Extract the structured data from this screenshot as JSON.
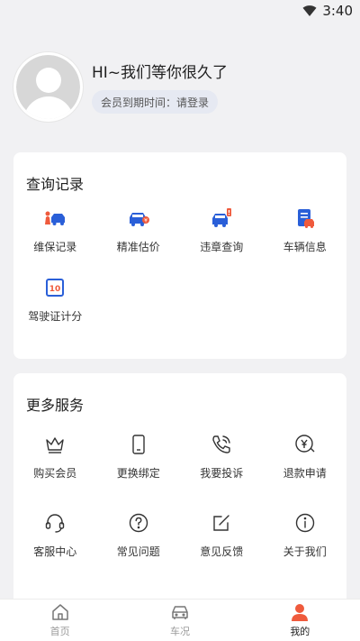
{
  "status_bar": {
    "time": "3:40"
  },
  "profile": {
    "greeting": "HI~我们等你很久了",
    "membership": "会员到期时间：请登录"
  },
  "query_records": {
    "title": "查询记录",
    "items": [
      {
        "label": "维保记录",
        "icon": "maintenance-icon"
      },
      {
        "label": "精准估价",
        "icon": "valuation-icon"
      },
      {
        "label": "违章查询",
        "icon": "violation-icon"
      },
      {
        "label": "车辆信息",
        "icon": "vehicle-info-icon"
      },
      {
        "label": "驾驶证计分",
        "icon": "license-points-icon"
      }
    ]
  },
  "more_services": {
    "title": "更多服务",
    "items": [
      {
        "label": "购买会员",
        "icon": "crown-icon"
      },
      {
        "label": "更换绑定",
        "icon": "phone-icon"
      },
      {
        "label": "我要投诉",
        "icon": "call-icon"
      },
      {
        "label": "退款申请",
        "icon": "refund-icon"
      },
      {
        "label": "客服中心",
        "icon": "headset-icon"
      },
      {
        "label": "常见问题",
        "icon": "question-icon"
      },
      {
        "label": "意见反馈",
        "icon": "feedback-icon"
      },
      {
        "label": "关于我们",
        "icon": "info-icon"
      }
    ]
  },
  "bottom_nav": {
    "tabs": [
      {
        "label": "首页",
        "icon": "home-icon"
      },
      {
        "label": "车况",
        "icon": "car-icon"
      },
      {
        "label": "我的",
        "icon": "user-icon"
      }
    ],
    "active_index": 2
  },
  "colors": {
    "brand_blue": "#2a5fd8",
    "accent_red": "#ef5a3c",
    "muted": "#9a9a9a"
  }
}
